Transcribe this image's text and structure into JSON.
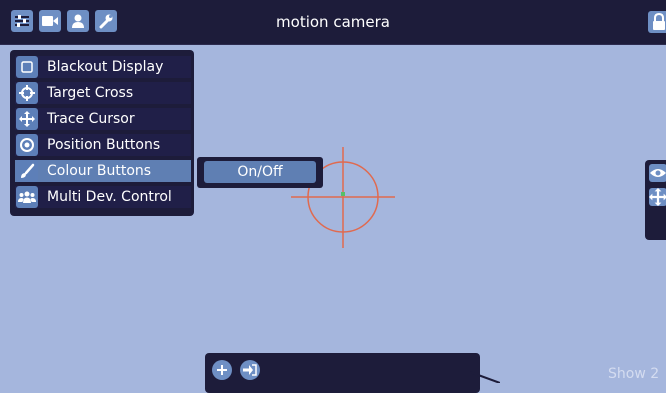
{
  "header": {
    "title": "motion camera",
    "left_icons": [
      "sliders-icon",
      "camera-icon",
      "user-icon",
      "wrench-icon"
    ],
    "right_icon": "lock-icon"
  },
  "menu": {
    "items": [
      {
        "label": "Blackout Display",
        "icon": "square-icon",
        "active": false
      },
      {
        "label": "Target Cross",
        "icon": "crosshair-icon",
        "active": false
      },
      {
        "label": "Trace Cursor",
        "icon": "move-arrows-icon",
        "active": false
      },
      {
        "label": "Position Buttons",
        "icon": "target-circle-icon",
        "active": false
      },
      {
        "label": "Colour Buttons",
        "icon": "brush-icon",
        "active": true
      },
      {
        "label": "Multi Dev. Control",
        "icon": "group-icon",
        "active": false
      }
    ]
  },
  "submenu": {
    "toggle_label": "On/Off"
  },
  "right_panel": {
    "icons": [
      "eye-icon",
      "move-arrows-icon"
    ]
  },
  "bottom_bar": {
    "icons": [
      "plus-icon",
      "login-icon"
    ]
  },
  "footer": {
    "show_label": "Show 2"
  },
  "colors": {
    "background": "#a5b6dd",
    "panel": "#1d1c3a",
    "accent": "#5f7fb3",
    "crosshair": "#e06a4f"
  }
}
